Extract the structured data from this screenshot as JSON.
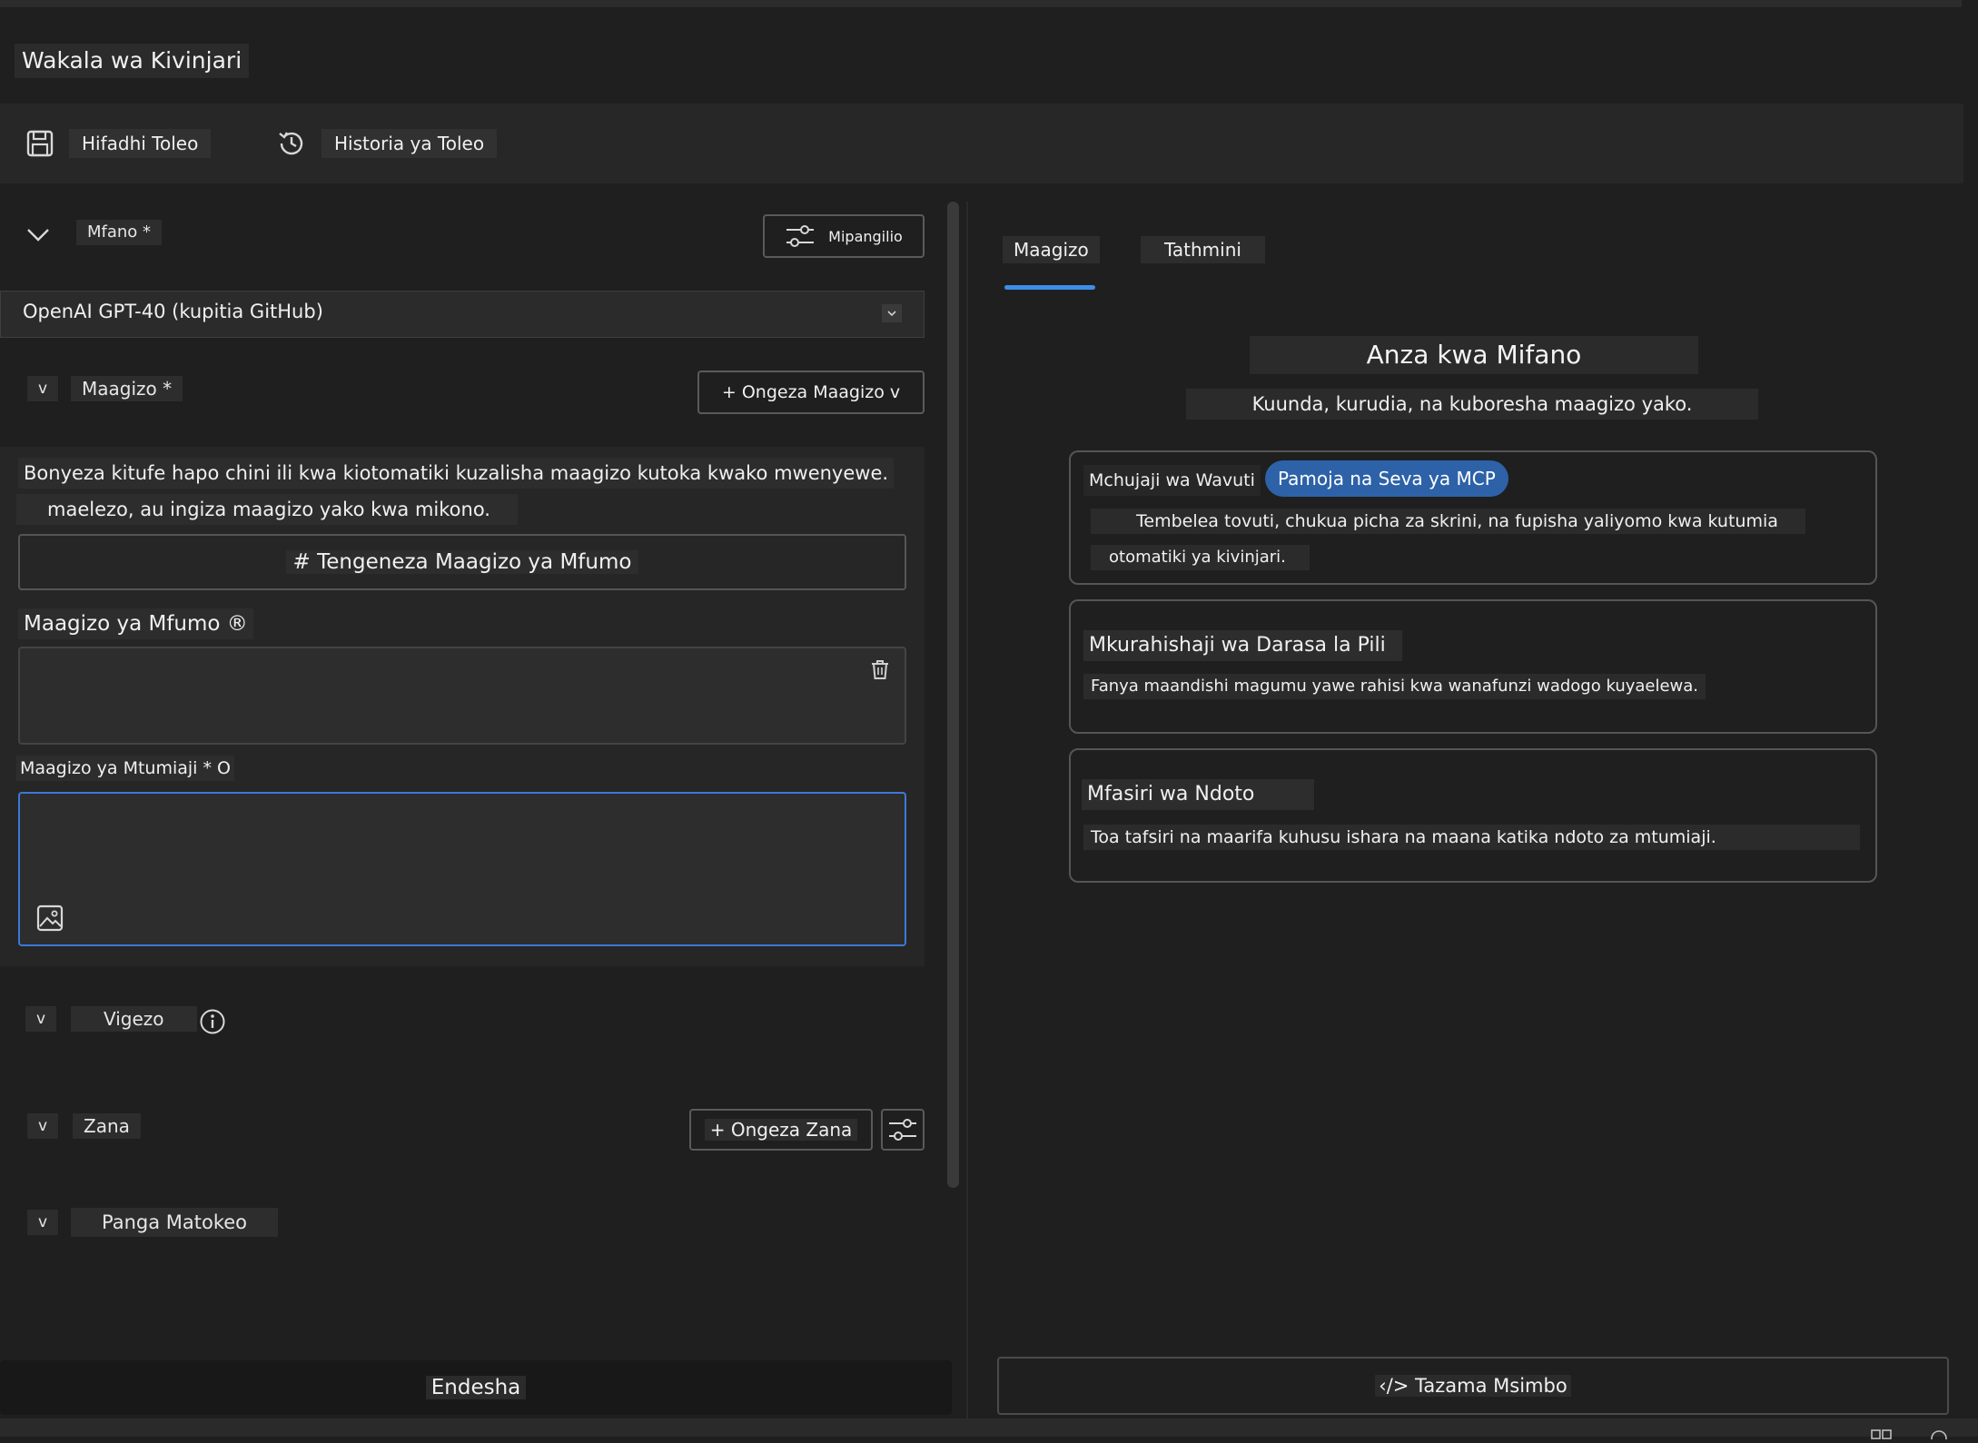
{
  "app": {
    "title": "Wakala wa Kivinjari"
  },
  "toolbar": {
    "save_label": "Hifadhi Toleo",
    "history_label": "Historia ya Toleo"
  },
  "model": {
    "section_label": "Mfano *",
    "settings_label": "Mipangilio",
    "selected_value": "OpenAI GPT-40 (kupitia GitHub)"
  },
  "instructions": {
    "section_label": "Maagizo *",
    "add_label": "+ Ongeza Maagizo v",
    "description_line1": "Bonyeza kitufe hapo chini ili kwa kiotomatiki kuzalisha maagizo kutoka kwako mwenyewe.",
    "description_line2": "maelezo, au ingiza maagizo yako kwa mikono.",
    "generate_label": "# Tengeneza Maagizo ya Mfumo",
    "system_label": "Maagizo ya Mfumo ®",
    "user_label": "Maagizo ya Mtumiaji * O"
  },
  "variables": {
    "section_label": "Vigezo"
  },
  "tools": {
    "section_label": "Zana",
    "add_label": "+ Ongeza Zana"
  },
  "output": {
    "section_label": "Panga Matokeo"
  },
  "run": {
    "label": "Endesha"
  },
  "tabs": [
    {
      "label": "Maagizo",
      "active": true
    },
    {
      "label": "Tathmini",
      "active": false
    }
  ],
  "examples": {
    "title": "Anza kwa Mifano",
    "subtitle": "Kuunda, kurudia, na kuboresha maagizo yako.",
    "cards": [
      {
        "title": "Mchujaji wa Wavuti",
        "badge": "Pamoja na Seva ya MCP",
        "description_line1": "Tembelea tovuti, chukua picha za skrini, na fupisha yaliyomo kwa kutumia",
        "description_line2": "otomatiki ya kivinjari."
      },
      {
        "title": "Mkurahishaji wa Darasa la Pili",
        "description_line1": "Fanya maandishi magumu yawe rahisi kwa wanafunzi wadogo kuyaelewa."
      },
      {
        "title": "Mfasiri wa Ndoto",
        "description_line1": "Toa tafsiri na maarifa kuhusu ishara na maana katika ndoto za mtumiaji."
      }
    ]
  },
  "view_code": {
    "label": "‹/> Tazama Msimbo"
  },
  "colors": {
    "background": "#1f1f1f",
    "accent": "#3d8ee8",
    "badge": "#2d62a8",
    "focus_border": "#3d78d8"
  }
}
